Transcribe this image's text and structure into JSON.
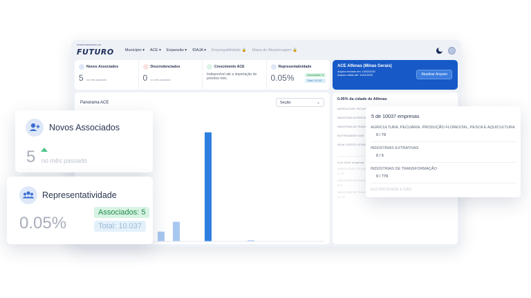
{
  "nav": {
    "logo": "FUTURO",
    "logo_tag": "OPORTUNIDADES DO",
    "items": [
      {
        "label": "Município",
        "arrow": "▾",
        "enabled": true
      },
      {
        "label": "ACE",
        "arrow": "▾",
        "enabled": true
      },
      {
        "label": "Expansão",
        "arrow": "▾",
        "enabled": true
      },
      {
        "label": "IDAJA",
        "arrow": "▾",
        "enabled": true
      },
      {
        "label": "Empregabilidade",
        "arrow": "🔒",
        "enabled": false
      },
      {
        "label": "Mapa de Abastecagem",
        "arrow": "🔒",
        "enabled": false
      }
    ]
  },
  "kpis": {
    "novos": {
      "title": "Novos Associados",
      "value": "5",
      "sub": "no mês passado"
    },
    "descred": {
      "title": "Descredenciados",
      "value": "0",
      "sub": "no mês passado"
    },
    "cresc": {
      "title": "Crescimento ACE",
      "text": "Indisponível até a importação do próximo mês."
    },
    "rep": {
      "title": "Representatividade",
      "value": "0.05%",
      "assoc": "Associados: 5",
      "total": "Total: 10.037"
    }
  },
  "ace_card": {
    "title": "ACE Alfenas (Minas Gerais)",
    "line1": "Arquivo enviado em: 10/02/2025",
    "line2": "Arquivo válido até: 11/04/2025",
    "button": "Atualizar Arquivo"
  },
  "panorama": {
    "title": "Panorama ACE",
    "select_value": "Seção"
  },
  "side": {
    "title": "0.05% da cidade de Alfenas",
    "items": [
      "AGRICULTURA, PECUÁRIA...",
      "INDÚSTRIAS EXTRATIVAS",
      "INDÚSTRIAS DE TRANSFORMAÇÃO",
      "ELETRICIDADE E GÁS",
      "ÁGUA, ESGOTO, ATIVIDADES DE GESTÃO DE RESÍDUOS E DESCONTAMINAÇÃO"
    ],
    "sub_title": "5 de 10037 empresas",
    "sub_items": [
      {
        "label": "AGRICULTURA, PECUÁRIA, PRODUÇÃO FLORESTAL, PESCA E AQUICULTURA",
        "count": "0 / 79"
      },
      {
        "label": "INDÚSTRIAS EXTRATIVAS",
        "count": "0 / 5"
      },
      {
        "label": "INDÚSTRIAS DE TRANSFORMAÇÃO",
        "count": "0 / 779"
      }
    ]
  },
  "overlay_novos": {
    "title": "Novos Associados",
    "value": "5",
    "sub": "no mês passado"
  },
  "overlay_rep": {
    "title": "Representatividade",
    "value": "0.05%",
    "assoc": "Associados: 5",
    "total": "Total: 10.037"
  },
  "overlay_emp": {
    "title": "5 de 10037 empresas",
    "rows": [
      {
        "label": "AGRICULTURA, PECUÁRIA, PRODUÇÃO FLORESTAL, PESCA E AQUICULTURA",
        "count": "0 / 79"
      },
      {
        "label": "INDÚSTRIAS EXTRATIVAS",
        "count": "0 / 5"
      },
      {
        "label": "INDÚSTRIAS DE TRANSFORMAÇÃO",
        "count": "0 / 779"
      }
    ],
    "faded": "ELETRICIDADE E GÁS"
  },
  "chart_data": {
    "type": "bar",
    "values": [
      5,
      9,
      18,
      100,
      1
    ],
    "ylim": [
      0,
      110
    ]
  },
  "colors": {
    "accent": "#1659c7",
    "bar": "#2f7fe0",
    "bar_light": "#a9c8f0"
  }
}
